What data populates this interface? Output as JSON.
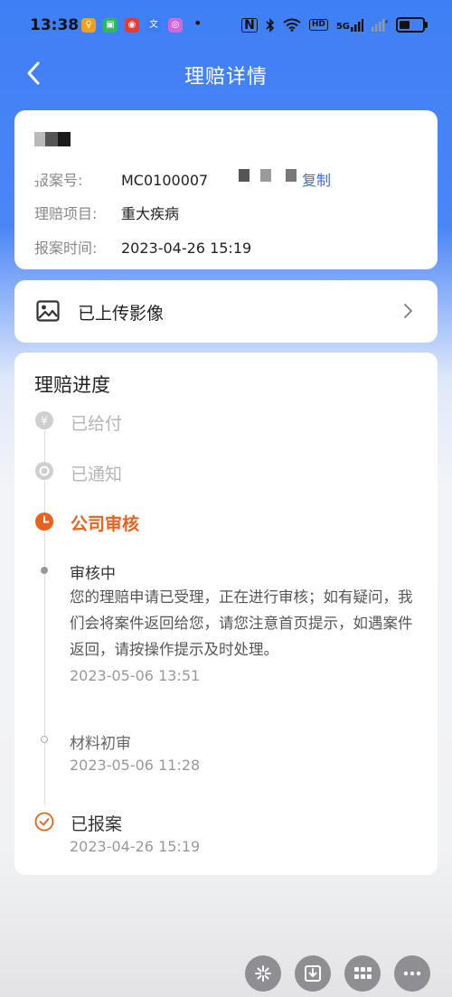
{
  "status_bar": {
    "time": "13:38",
    "nfc": "N",
    "hd": "HD",
    "signal": "5G",
    "battery_level": 0.55
  },
  "nav": {
    "title": "理赔详情"
  },
  "claim_info": {
    "report_no_label": "报案号:",
    "report_no_value": "MC0100007",
    "copy_label": "复制",
    "item_label": "理赔项目:",
    "item_value": "重大疾病",
    "time_label": "报案时间:",
    "time_value": "2023-04-26 15:19"
  },
  "upload": {
    "label": "已上传影像"
  },
  "progress": {
    "title": "理赔进度",
    "steps": [
      {
        "label": "已给付",
        "state": "pending"
      },
      {
        "label": "已通知",
        "state": "pending"
      },
      {
        "label": "公司审核",
        "state": "active"
      }
    ],
    "sub_steps": [
      {
        "title": "审核中",
        "desc": "您的理赔申请已受理，正在进行审核；如有疑问，我们会将案件返回给您，请您注意首页提示，如遇案件返回，请按操作提示及时处理。",
        "time": "2023-05-06 13:51"
      },
      {
        "title": "材料初审",
        "time": "2023-05-06 11:28"
      }
    ],
    "reported": {
      "label": "已报案",
      "time": "2023-04-26 15:19"
    }
  },
  "colors": {
    "brand_blue": "#3f7ff5",
    "active_orange": "#e8621d",
    "link_blue": "#3a6fd8"
  }
}
